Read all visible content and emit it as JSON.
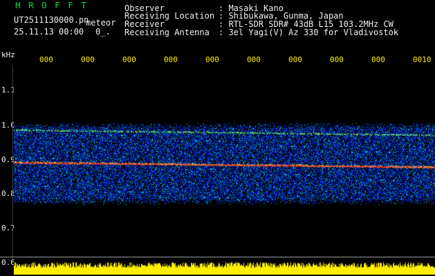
{
  "header": {
    "app_name": "H R O F F T",
    "filename": "UT2511130000.pn",
    "meteor_label": "meteor",
    "datetime": "25.11.13 00:00",
    "count": "0_.",
    "info": [
      {
        "label": "Observer",
        "value": ": Masaki Kano"
      },
      {
        "label": "Receiving Location",
        "value": ": Shibukawa, Gunma, Japan"
      },
      {
        "label": "Receiver",
        "value": ": RTL-SDR SDR# 43dB L15 103.2MHz CW"
      },
      {
        "label": "Receiving Antenna",
        "value": ": 3el Yagi(V) Az 330 for Vladivostok"
      }
    ]
  },
  "axis": {
    "unit": "kHz",
    "y_ticks": [
      "1.1",
      "1.0",
      "0.9",
      "0.8",
      "0.7",
      "0.6"
    ],
    "x_ticks": [
      "000",
      "000",
      "000",
      "000",
      "000",
      "000",
      "000",
      "000",
      "000",
      "0010"
    ]
  },
  "colors": {
    "header_green": "#00e040",
    "tick_yellow": "#ffea00",
    "noise_blue": "#1a3aff",
    "signal_red": "#ff3020",
    "signal_green": "#40ff80",
    "level_yellow": "#ffee00"
  }
}
